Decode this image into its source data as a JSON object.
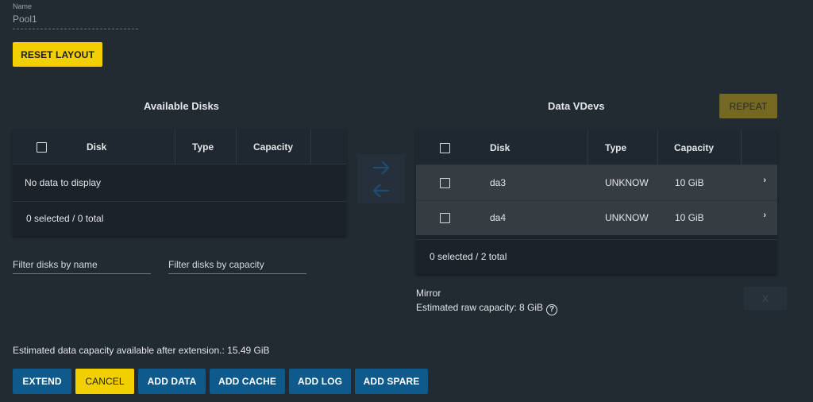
{
  "name_field": {
    "label": "Name",
    "value": "Pool1"
  },
  "reset_layout": "RESET LAYOUT",
  "available": {
    "title": "Available Disks",
    "columns": [
      "Disk",
      "Type",
      "Capacity"
    ],
    "empty": "No data to display",
    "footer": "0 selected / 0 total"
  },
  "filters": {
    "by_name": "Filter disks by name",
    "by_capacity": "Filter disks by capacity"
  },
  "data_vdevs": {
    "title": "Data VDevs",
    "repeat": "REPEAT",
    "columns": [
      "Disk",
      "Type",
      "Capacity"
    ],
    "rows": [
      {
        "disk": "da3",
        "type": "UNKNOW",
        "capacity": "10 GiB"
      },
      {
        "disk": "da4",
        "type": "UNKNOW",
        "capacity": "10 GiB"
      }
    ],
    "footer": "0 selected / 2 total",
    "layout_type": "Mirror",
    "raw_capacity": "Estimated raw capacity: 8 GiB",
    "close": "X"
  },
  "estimated": "Estimated data capacity available after extension.: 15.49 GiB",
  "actions": {
    "extend": "EXTEND",
    "cancel": "CANCEL",
    "add_data": "ADD DATA",
    "add_cache": "ADD CACHE",
    "add_log": "ADD LOG",
    "add_spare": "ADD SPARE"
  },
  "icons": {
    "move_right": "arrow-right-icon",
    "move_left": "arrow-left-icon",
    "help": "help-circle-icon",
    "row_expand": "chevron-right-icon"
  },
  "colors": {
    "background": "#222a32",
    "accent_yellow": "#f2cf00",
    "primary_blue": "#0e5a8c",
    "table_bg": "#1b2229",
    "selected_row": "#353c42"
  }
}
